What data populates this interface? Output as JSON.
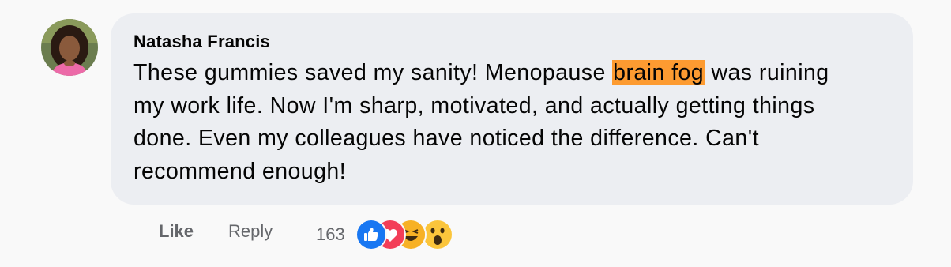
{
  "comment": {
    "author": "Natasha Francis",
    "text_before": "These gummies saved my sanity! Menopause ",
    "highlighted": "brain fog",
    "text_after": " was ruining my work life. Now I'm sharp, motivated, and actually getting things done. Even my colleagues have noticed the difference. Can't recommend enough!",
    "highlight_color": "#fd9b31"
  },
  "actions": {
    "like_label": "Like",
    "reply_label": "Reply",
    "reaction_count": "163",
    "reactions": [
      "like-icon",
      "love-icon",
      "haha-icon",
      "wow-icon"
    ]
  },
  "colors": {
    "bubble": "#eceef2",
    "muted_text": "#65676b",
    "like_blue": "#1877f2",
    "love_red": "#f33e58"
  }
}
